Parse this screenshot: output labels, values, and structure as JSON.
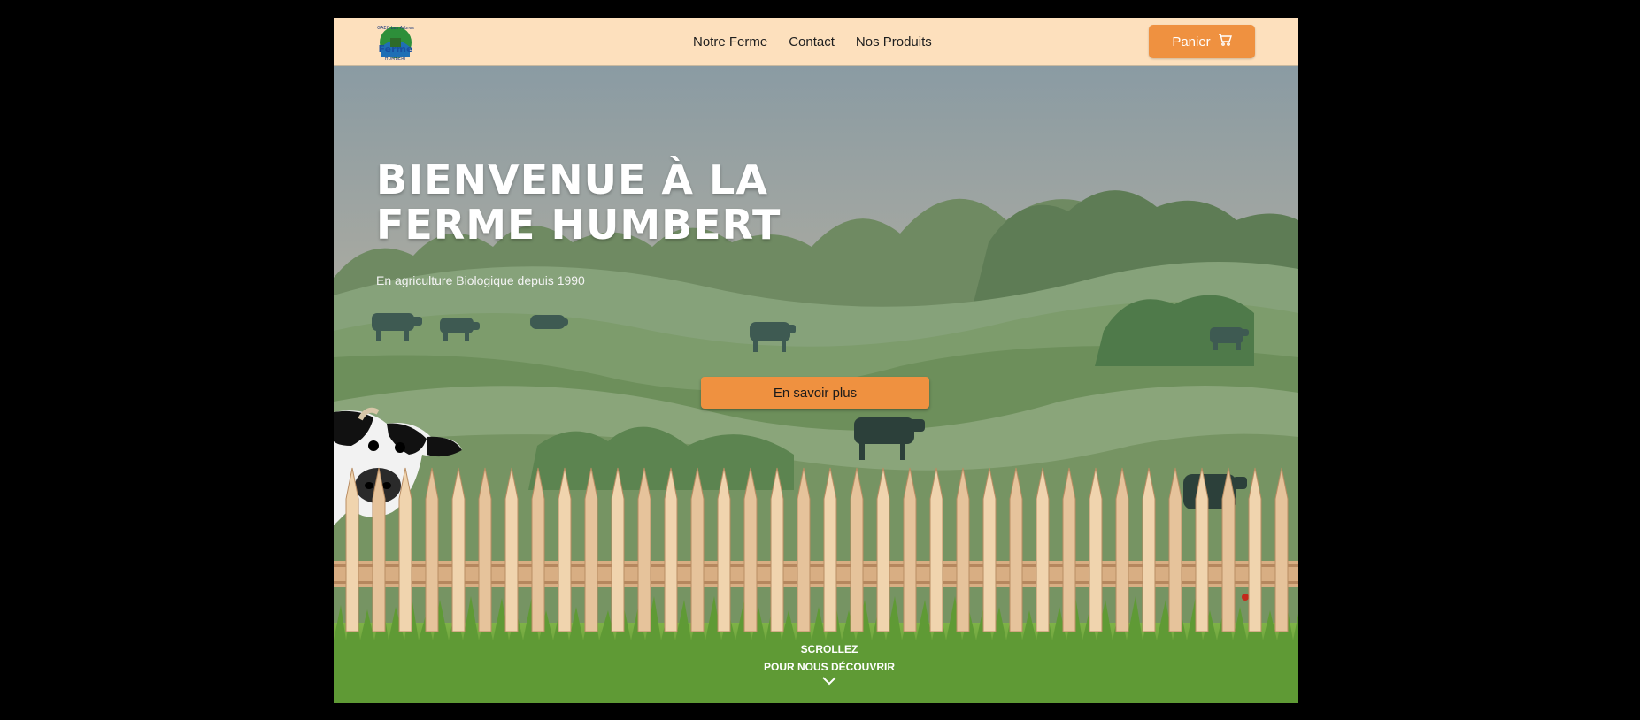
{
  "header": {
    "logo_text": "GAEC Les Arbres Ferme Humbert",
    "nav": [
      {
        "label": "Notre Ferme"
      },
      {
        "label": "Contact"
      },
      {
        "label": "Nos Produits"
      }
    ],
    "cart_label": "Panier",
    "cart_icon": "cart-icon"
  },
  "hero": {
    "title_line1": "Bienvenue à la",
    "title_line2": "ferme Humbert",
    "subtitle": "En agriculture Biologique depuis 1990",
    "cta_label": "En savoir plus",
    "scroll_line1": "SCROLLEZ",
    "scroll_line2": "POUR NOUS DÉCOUVRIR",
    "scroll_icon": "chevron-down-icon"
  },
  "colors": {
    "header_bg": "#fde0bd",
    "accent": "#ef9140",
    "sky_top": "#8a9ba3",
    "hill_green": "#6f8e60"
  }
}
